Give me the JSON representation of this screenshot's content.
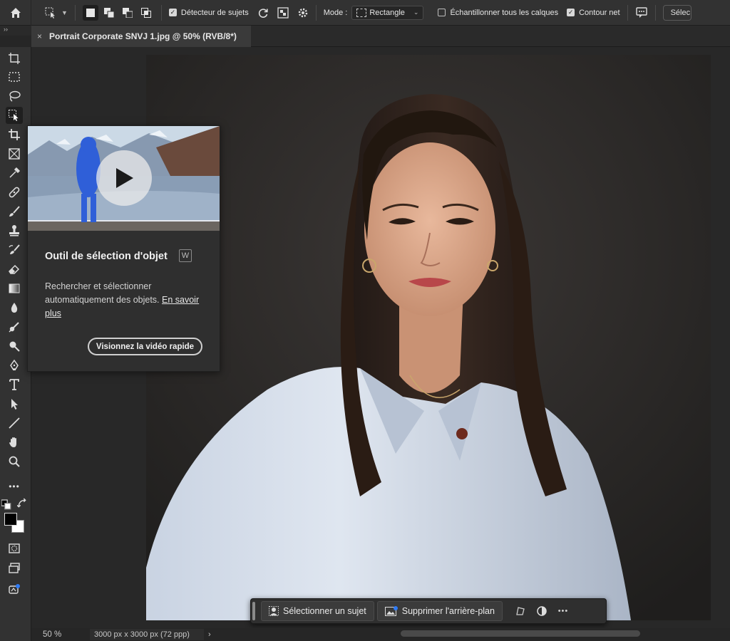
{
  "options_bar": {
    "subject_detector_label": "Détecteur de sujets",
    "mode_label": "Mode :",
    "mode_value": "Rectangle",
    "sample_all_layers_label": "Échantillonner tous les calques",
    "hard_edge_label": "Contour net",
    "select_label": "Sélec"
  },
  "collapse_label": "››",
  "document_tab": {
    "title": "Portrait Corporate SNVJ 1.jpg @ 50% (RVB/8*)",
    "close_glyph": "×"
  },
  "tooltip": {
    "title": "Outil de sélection d'objet",
    "shortcut": "W",
    "description": "Rechercher et sélectionner automatiquement des objets.",
    "learn_more": "En savoir plus",
    "video_button": "Visionnez la vidéo rapide"
  },
  "context_bar": {
    "select_subject": "Sélectionner un sujet",
    "remove_background": "Supprimer l'arrière-plan",
    "more": "•••"
  },
  "status_bar": {
    "zoom": "50 %",
    "dimensions": "3000 px x 3000 px (72 ppp)",
    "arrow": "›"
  },
  "toolbar": {
    "more_tools": "•••",
    "tools": [
      "artboard-icon",
      "marquee-icon",
      "lasso-icon",
      "object-select-icon",
      "crop-icon",
      "frame-icon",
      "eyedropper-icon",
      "healing-brush-icon",
      "brush-icon",
      "stamp-icon",
      "history-brush-icon",
      "eraser-icon",
      "gradient-icon",
      "blur-icon",
      "dodge-icon",
      "burn-icon",
      "pen-icon",
      "type-icon",
      "path-select-icon",
      "line-icon",
      "hand-icon",
      "zoom-icon"
    ]
  },
  "colors": {
    "accent": "#2f7bf5",
    "panel": "#323232",
    "canvas_bg": "#282828"
  }
}
